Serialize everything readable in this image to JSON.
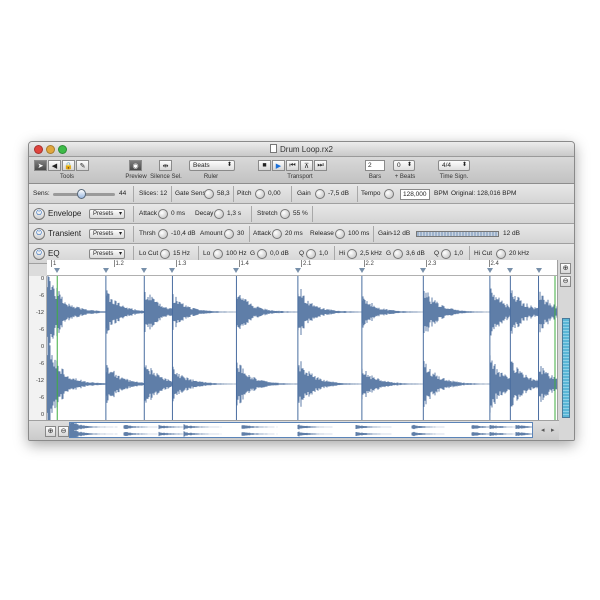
{
  "window": {
    "title": "Drum Loop.rx2"
  },
  "toolbar": {
    "labels": {
      "tools": "Tools",
      "preview": "Preview",
      "silence": "Silence Sel.",
      "ruler": "Ruler",
      "transport": "Transport",
      "bars": "Bars",
      "beats": "+ Beats",
      "timesig": "Time Sign."
    },
    "ruler_value": "Beats",
    "bars_value": "2",
    "beats_value": "0",
    "timesig_value": "4/4"
  },
  "row1": {
    "sens_label": "Sens:",
    "sens_value": "44",
    "slices": "Slices: 12",
    "gate_label": "Gate Sens",
    "gate_value": "58,3",
    "pitch_label": "Pitch",
    "pitch_value": "0,00",
    "gain_label": "Gain",
    "gain_value": "-7,5 dB",
    "tempo_label": "Tempo",
    "tempo_value": "128,000",
    "bpm": "BPM",
    "original": "Original: 128,016 BPM"
  },
  "envelope": {
    "name": "Envelope",
    "presets": "Presets",
    "attack_label": "Attack",
    "attack_value": "0 ms",
    "decay_label": "Decay",
    "decay_value": "1,3 s",
    "stretch_label": "Stretch",
    "stretch_value": "55 %"
  },
  "transient": {
    "name": "Transient",
    "presets": "Presets",
    "thrsh_label": "Thrsh",
    "thrsh_value": "-10,4 dB",
    "amount_label": "Amount",
    "amount_value": "30",
    "attack_label": "Attack",
    "attack_value": "20 ms",
    "release_label": "Release",
    "release_value": "100 ms",
    "gain_label": "Gain",
    "gain_value": "-12 dB",
    "gain_max": "12 dB"
  },
  "eq": {
    "name": "EQ",
    "presets": "Presets",
    "locut_label": "Lo Cut",
    "locut_value": "15 Hz",
    "lo_label": "Lo",
    "lo_value": "100 Hz",
    "g1_label": "G",
    "g1_value": "0,0 dB",
    "q1_label": "Q",
    "q1_value": "1,0",
    "hi_label": "Hi",
    "hi_value": "2,5 kHz",
    "g2_label": "G",
    "g2_value": "3,6 dB",
    "q2_label": "Q",
    "q2_value": "1,0",
    "hicut_label": "Hi Cut",
    "hicut_value": "20 kHz"
  },
  "ruler": {
    "bars": [
      "1",
      "1.2",
      "1.3",
      "1.4",
      "2.1",
      "2.2",
      "2.3",
      "2.4"
    ]
  },
  "db_scale": [
    "0",
    "-6",
    "-12",
    "-6",
    "0",
    "-6",
    "-12",
    "-6",
    "0"
  ],
  "slices_positions": [
    0.02,
    0.115,
    0.19,
    0.245,
    0.37,
    0.49,
    0.615,
    0.735,
    0.865,
    0.905,
    0.96
  ]
}
